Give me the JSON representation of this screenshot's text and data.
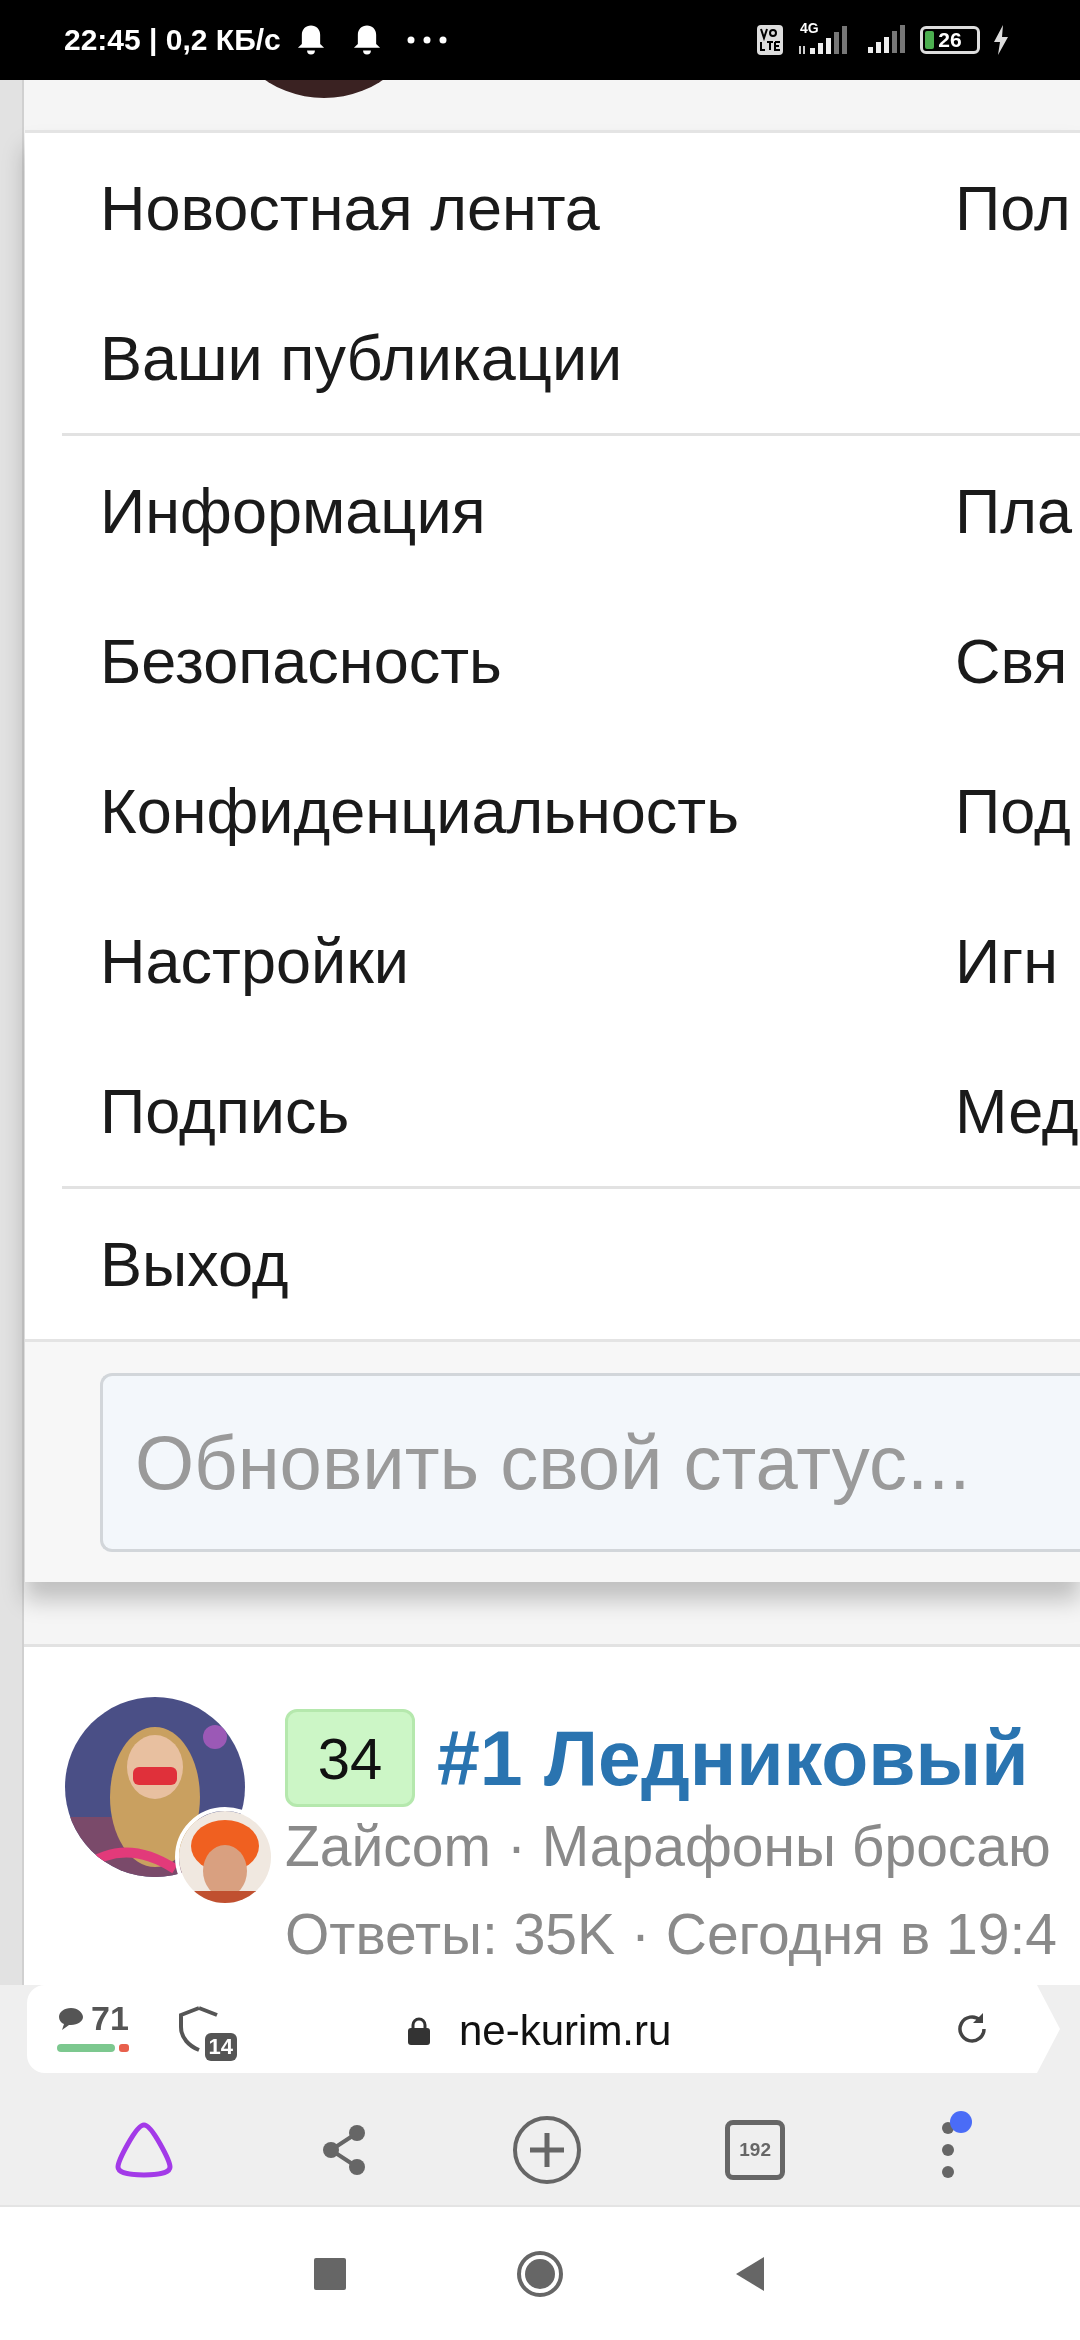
{
  "status_bar": {
    "time_speed": "22:45 | 0,2 КБ/с",
    "network": "4G",
    "battery": "26"
  },
  "menu": {
    "groups": [
      [
        {
          "label": "Новостная лента",
          "right": "Пол"
        },
        {
          "label": "Ваши публикации"
        }
      ],
      [
        {
          "label": "Информация",
          "right": "Пла"
        },
        {
          "label": "Безопасность",
          "right": "Свя"
        },
        {
          "label": "Конфиденциальность",
          "right": "Под"
        },
        {
          "label": "Настройки",
          "right": "Игн"
        },
        {
          "label": "Подпись",
          "right": "Мед"
        }
      ],
      [
        {
          "label": "Выход"
        }
      ]
    ],
    "status_field": {
      "placeholder": "Обновить свой статус..."
    }
  },
  "thread": {
    "badge": "34",
    "title": "#1 Ледниковый",
    "meta": "Zайcom · Марафоны бросаю",
    "stats": "Ответы: 35K · Сегодня в 19:4"
  },
  "browser": {
    "comments": "71",
    "trackers": "14",
    "url": "ne-kurim.ru",
    "tabs": "192",
    "menu_notification": true
  }
}
